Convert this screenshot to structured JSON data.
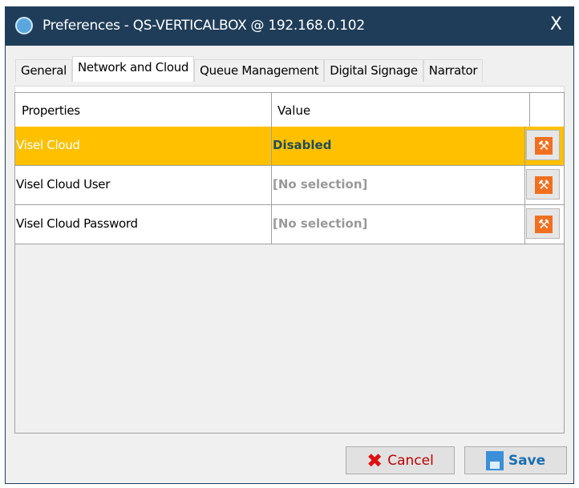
{
  "window": {
    "title": "Preferences - QS-VERTICALBOX @ 192.168.0.102",
    "close": "X"
  },
  "tabs": [
    {
      "label": "General"
    },
    {
      "label": "Network and Cloud"
    },
    {
      "label": "Queue Management"
    },
    {
      "label": "Digital Signage"
    },
    {
      "label": "Narrator"
    }
  ],
  "table": {
    "headers": [
      "Properties",
      "Value"
    ],
    "rows": [
      {
        "property": "Visel Cloud",
        "value": "Disabled"
      },
      {
        "property": "Visel Cloud User",
        "value": "[No selection]"
      },
      {
        "property": "Visel Cloud Password",
        "value": "[No selection]"
      }
    ]
  },
  "buttons": {
    "cancel": "Cancel",
    "save": "Save"
  },
  "colors": {
    "titlebar": "#1f3d58",
    "selected_row": "#ffc000",
    "action": "#f07020"
  }
}
